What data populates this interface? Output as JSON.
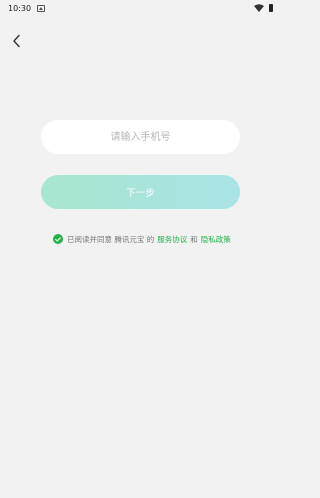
{
  "status": {
    "time": "10:30"
  },
  "form": {
    "phone_placeholder": "请输入手机号",
    "next_label": "下一步"
  },
  "agreement": {
    "prefix": "已阅读并同意 腾讯元宝 的",
    "service_link": "服务协议",
    "and": "和",
    "privacy_link": "隐私政策"
  },
  "colors": {
    "accent_green": "#22b24c",
    "button_gradient_start": "#a8e6cf",
    "button_gradient_end": "#a9e3e6",
    "background": "#f2f2f2"
  },
  "icons": [
    "image-icon",
    "wifi-icon",
    "battery-icon",
    "back-arrow-icon",
    "check-circle-icon"
  ]
}
